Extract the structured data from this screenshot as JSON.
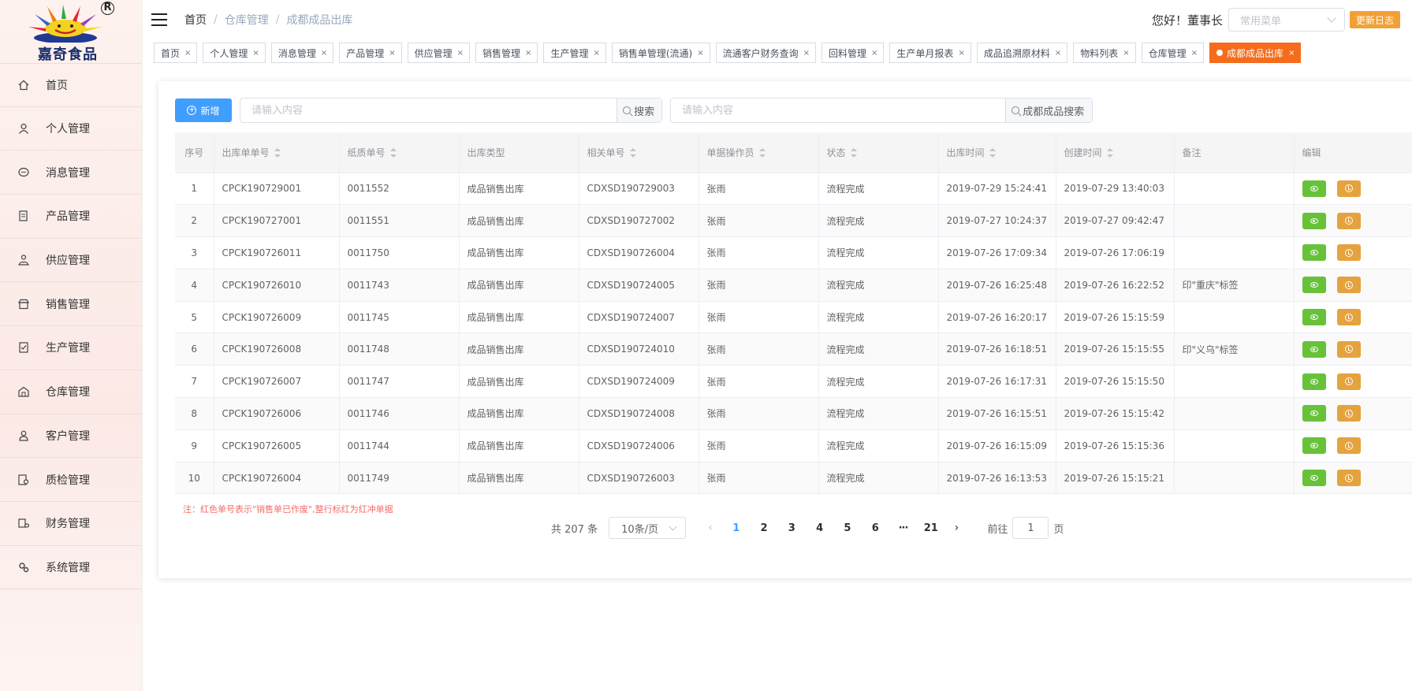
{
  "brand": {
    "name": "嘉奇食品",
    "registered_mark": "R"
  },
  "sidebar": {
    "items": [
      {
        "label": "首页",
        "icon": "home-icon"
      },
      {
        "label": "个人管理",
        "icon": "user-icon"
      },
      {
        "label": "消息管理",
        "icon": "message-icon"
      },
      {
        "label": "产品管理",
        "icon": "document-icon"
      },
      {
        "label": "供应管理",
        "icon": "supply-icon"
      },
      {
        "label": "销售管理",
        "icon": "shop-icon"
      },
      {
        "label": "生产管理",
        "icon": "checklist-icon"
      },
      {
        "label": "仓库管理",
        "icon": "warehouse-icon"
      },
      {
        "label": "客户管理",
        "icon": "customer-icon"
      },
      {
        "label": "质检管理",
        "icon": "inspection-icon"
      },
      {
        "label": "财务管理",
        "icon": "finance-icon"
      },
      {
        "label": "系统管理",
        "icon": "settings-icon"
      }
    ]
  },
  "header": {
    "breadcrumb": [
      "首页",
      "仓库管理",
      "成都成品出库"
    ],
    "greeting": "您好！董事长",
    "quick_menu_placeholder": "常用菜单",
    "update_log": "更新日志"
  },
  "tabs": [
    {
      "label": "首页"
    },
    {
      "label": "个人管理"
    },
    {
      "label": "消息管理"
    },
    {
      "label": "产品管理"
    },
    {
      "label": "供应管理"
    },
    {
      "label": "销售管理"
    },
    {
      "label": "生产管理"
    },
    {
      "label": "销售单管理(流通)"
    },
    {
      "label": "流通客户财务查询"
    },
    {
      "label": "回料管理"
    },
    {
      "label": "生产单月报表"
    },
    {
      "label": "成品追溯原材料"
    },
    {
      "label": "物料列表"
    },
    {
      "label": "仓库管理"
    },
    {
      "label": "成都成品出库",
      "active": true
    }
  ],
  "toolbar": {
    "add_label": "新增",
    "search_placeholder": "请输入内容",
    "search_label": "搜索",
    "search2_placeholder": "请输入内容",
    "search2_label": "成都成品搜索"
  },
  "table": {
    "columns": [
      "序号",
      "出库单单号",
      "纸质单号",
      "出库类型",
      "相关单号",
      "单据操作员",
      "状态",
      "出库时间",
      "创建时间",
      "备注",
      "编辑"
    ],
    "rows": [
      [
        "1",
        "CPCK190729001",
        "0011552",
        "成品销售出库",
        "CDXSD190729003",
        "张雨",
        "流程完成",
        "2019-07-29 15:24:41",
        "2019-07-29 13:40:03",
        ""
      ],
      [
        "2",
        "CPCK190727001",
        "0011551",
        "成品销售出库",
        "CDXSD190727002",
        "张雨",
        "流程完成",
        "2019-07-27 10:24:37",
        "2019-07-27 09:42:47",
        ""
      ],
      [
        "3",
        "CPCK190726011",
        "0011750",
        "成品销售出库",
        "CDXSD190726004",
        "张雨",
        "流程完成",
        "2019-07-26 17:09:34",
        "2019-07-26 17:06:19",
        ""
      ],
      [
        "4",
        "CPCK190726010",
        "0011743",
        "成品销售出库",
        "CDXSD190724005",
        "张雨",
        "流程完成",
        "2019-07-26 16:25:48",
        "2019-07-26 16:22:52",
        "印\"重庆\"标签"
      ],
      [
        "5",
        "CPCK190726009",
        "0011745",
        "成品销售出库",
        "CDXSD190724007",
        "张雨",
        "流程完成",
        "2019-07-26 16:20:17",
        "2019-07-26 15:15:59",
        ""
      ],
      [
        "6",
        "CPCK190726008",
        "0011748",
        "成品销售出库",
        "CDXSD190724010",
        "张雨",
        "流程完成",
        "2019-07-26 16:18:51",
        "2019-07-26 15:15:55",
        "印\"义乌\"标签"
      ],
      [
        "7",
        "CPCK190726007",
        "0011747",
        "成品销售出库",
        "CDXSD190724009",
        "张雨",
        "流程完成",
        "2019-07-26 16:17:31",
        "2019-07-26 15:15:50",
        ""
      ],
      [
        "8",
        "CPCK190726006",
        "0011746",
        "成品销售出库",
        "CDXSD190724008",
        "张雨",
        "流程完成",
        "2019-07-26 16:15:51",
        "2019-07-26 15:15:42",
        ""
      ],
      [
        "9",
        "CPCK190726005",
        "0011744",
        "成品销售出库",
        "CDXSD190724006",
        "张雨",
        "流程完成",
        "2019-07-26 16:15:09",
        "2019-07-26 15:15:36",
        ""
      ],
      [
        "10",
        "CPCK190726004",
        "0011749",
        "成品销售出库",
        "CDXSD190726003",
        "张雨",
        "流程完成",
        "2019-07-26 16:13:53",
        "2019-07-26 15:15:21",
        ""
      ]
    ]
  },
  "note": "注：红色单号表示\"销售单已作废\",整行标红为红冲单据",
  "pagination": {
    "total": "共 207 条",
    "page_size": "10条/页",
    "pages": [
      "1",
      "2",
      "3",
      "4",
      "5",
      "6",
      "···",
      "21"
    ],
    "current": "1",
    "goto_prefix": "前往",
    "goto_value": "1",
    "goto_suffix": "页"
  },
  "colors": {
    "primary": "#409eff",
    "active_tab": "#f56c1c",
    "view": "#67c23a",
    "history": "#e6a23c",
    "update": "#f2a036"
  }
}
